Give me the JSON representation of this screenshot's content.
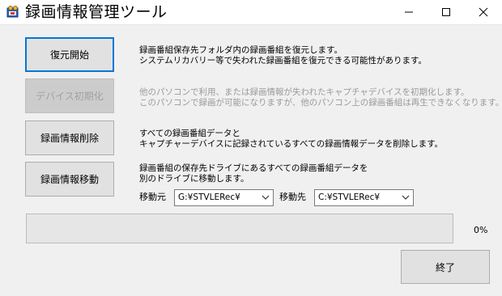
{
  "window": {
    "title": "録画情報管理ツール",
    "icon": "app-icon",
    "controls": [
      "minimize-icon",
      "maximize-icon",
      "close-icon"
    ]
  },
  "actions": {
    "restore": {
      "label": "復元開始",
      "description": [
        "録画番組保存先フォルダ内の録画番組を復元します。",
        "システムリカバリー等で失われた録画番組を復元できる可能性があります。"
      ],
      "enabled": true,
      "default": true
    },
    "init_device": {
      "label": "デバイス初期化",
      "description": [
        "他のパソコンで利用、または録画情報が失われたキャプチャデバイスを初期化します。",
        "このパソコンで録画が可能になりますが、他のパソコン上の録画番組は再生できなくなります。"
      ],
      "enabled": false
    },
    "delete_info": {
      "label": "録画情報削除",
      "description": [
        "すべての録画番組データと",
        "キャプチャーデバイスに記録されているすべての録画情報データを削除します。"
      ],
      "enabled": true
    },
    "move_info": {
      "label": "録画情報移動",
      "description": [
        "録画番組の保存先ドライブにあるすべての録画番組データを",
        "別のドライブに移動します。"
      ],
      "enabled": true,
      "source_label": "移動元",
      "source_value": "G:¥STVLERec¥",
      "dest_label": "移動先",
      "dest_value": "C:¥STVLERec¥"
    }
  },
  "progress": {
    "value": 0,
    "text": "0%"
  },
  "footer": {
    "close_label": "終了"
  },
  "colors": {
    "accent": "#0078d7",
    "progress_fill": "#06b025",
    "background": "#f0f0f0"
  }
}
